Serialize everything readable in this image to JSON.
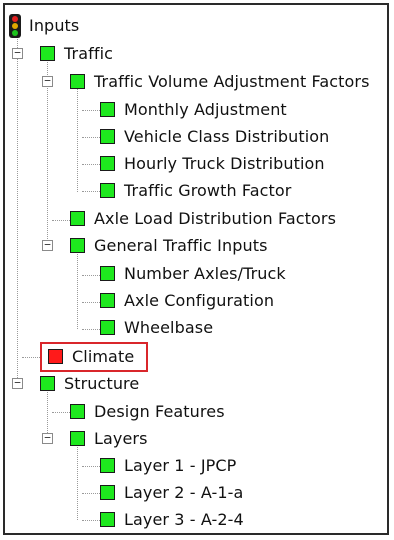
{
  "colors": {
    "ok": "#1ee81e",
    "error": "#ff1a1a",
    "highlight": "#d9262b"
  },
  "root": {
    "label": "Inputs",
    "icon": "traffic-light-icon"
  },
  "nodes": [
    {
      "id": "traffic",
      "label": "Traffic",
      "status": "ok",
      "expanded": true
    },
    {
      "id": "tvaf",
      "label": "Traffic Volume Adjustment Factors",
      "status": "ok",
      "expanded": true
    },
    {
      "id": "monthly",
      "label": "Monthly Adjustment",
      "status": "ok"
    },
    {
      "id": "vcd",
      "label": "Vehicle Class Distribution",
      "status": "ok"
    },
    {
      "id": "htd",
      "label": "Hourly Truck Distribution",
      "status": "ok"
    },
    {
      "id": "tgf",
      "label": "Traffic Growth Factor",
      "status": "ok"
    },
    {
      "id": "aldf",
      "label": "Axle Load Distribution Factors",
      "status": "ok"
    },
    {
      "id": "gti",
      "label": "General Traffic Inputs",
      "status": "ok",
      "expanded": true
    },
    {
      "id": "nat",
      "label": "Number Axles/Truck",
      "status": "ok"
    },
    {
      "id": "axcfg",
      "label": "Axle Configuration",
      "status": "ok"
    },
    {
      "id": "wb",
      "label": "Wheelbase",
      "status": "ok"
    },
    {
      "id": "climate",
      "label": "Climate",
      "status": "error",
      "highlighted": true
    },
    {
      "id": "structure",
      "label": "Structure",
      "status": "ok",
      "expanded": true
    },
    {
      "id": "df",
      "label": "Design Features",
      "status": "ok"
    },
    {
      "id": "layers",
      "label": "Layers",
      "status": "ok",
      "expanded": true
    },
    {
      "id": "l1",
      "label": "Layer 1 - JPCP",
      "status": "ok"
    },
    {
      "id": "l2",
      "label": "Layer 2 - A-1-a",
      "status": "ok"
    },
    {
      "id": "l3",
      "label": "Layer 3 - A-2-4",
      "status": "ok"
    }
  ]
}
